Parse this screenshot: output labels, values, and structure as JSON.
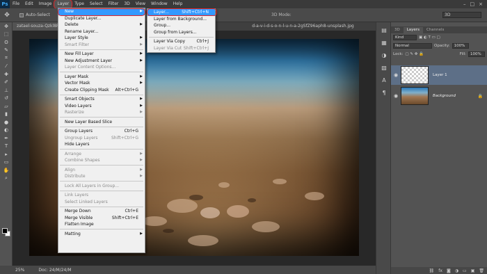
{
  "app": {
    "logo": "Ps"
  },
  "menubar": {
    "items": [
      "File",
      "Edit",
      "Image",
      "Layer",
      "Type",
      "Select",
      "Filter",
      "3D",
      "View",
      "Window",
      "Help"
    ],
    "active": "Layer"
  },
  "options": {
    "auto_select": "Auto-Select",
    "mode3d": "3D Mode:",
    "workspace": "3D"
  },
  "doctabs": {
    "tab1": "zatael-souza-Qzkl8P3A...",
    "tab2": "d-a-v-i-d-s-o-n-l-u-n-a-2gSfZ96aph8-unsplash.jpg"
  },
  "status": {
    "zoom": "25%",
    "doc": "Doc: 24/M/24/M"
  },
  "layer_menu": {
    "groups": [
      [
        {
          "label": "New",
          "arrow": true,
          "highlight": true
        },
        {
          "label": "Duplicate Layer...",
          "arrow": false
        },
        {
          "label": "Delete",
          "arrow": true
        },
        {
          "label": "Rename Layer...",
          "arrow": false
        },
        {
          "label": "Layer Style",
          "arrow": true
        },
        {
          "label": "Smart Filter",
          "arrow": true,
          "disabled": true
        }
      ],
      [
        {
          "label": "New Fill Layer",
          "arrow": true
        },
        {
          "label": "New Adjustment Layer",
          "arrow": true
        },
        {
          "label": "Layer Content Options...",
          "disabled": true
        }
      ],
      [
        {
          "label": "Layer Mask",
          "arrow": true
        },
        {
          "label": "Vector Mask",
          "arrow": true
        },
        {
          "label": "Create Clipping Mask",
          "shortcut": "Alt+Ctrl+G"
        }
      ],
      [
        {
          "label": "Smart Objects",
          "arrow": true
        },
        {
          "label": "Video Layers",
          "arrow": true
        },
        {
          "label": "Rasterize",
          "arrow": true,
          "disabled": true
        }
      ],
      [
        {
          "label": "New Layer Based Slice"
        }
      ],
      [
        {
          "label": "Group Layers",
          "shortcut": "Ctrl+G"
        },
        {
          "label": "Ungroup Layers",
          "shortcut": "Shift+Ctrl+G",
          "disabled": true
        },
        {
          "label": "Hide Layers"
        }
      ],
      [
        {
          "label": "Arrange",
          "arrow": true,
          "disabled": true
        },
        {
          "label": "Combine Shapes",
          "arrow": true,
          "disabled": true
        }
      ],
      [
        {
          "label": "Align",
          "arrow": true,
          "disabled": true
        },
        {
          "label": "Distribute",
          "arrow": true,
          "disabled": true
        }
      ],
      [
        {
          "label": "Lock All Layers in Group...",
          "disabled": true
        }
      ],
      [
        {
          "label": "Link Layers",
          "disabled": true
        },
        {
          "label": "Select Linked Layers",
          "disabled": true
        }
      ],
      [
        {
          "label": "Merge Down",
          "shortcut": "Ctrl+E"
        },
        {
          "label": "Merge Visible",
          "shortcut": "Shift+Ctrl+E"
        },
        {
          "label": "Flatten Image"
        }
      ],
      [
        {
          "label": "Matting",
          "arrow": true
        }
      ]
    ]
  },
  "new_submenu": {
    "groups": [
      [
        {
          "label": "Layer...",
          "shortcut": "Shift+Ctrl+N",
          "highlight": true
        },
        {
          "label": "Layer from Background..."
        },
        {
          "label": "Group..."
        },
        {
          "label": "Group from Layers..."
        }
      ],
      [
        {
          "label": "Layer Via Copy",
          "shortcut": "Ctrl+J"
        },
        {
          "label": "Layer Via Cut",
          "shortcut": "Shift+Ctrl+J",
          "disabled": true
        }
      ]
    ]
  },
  "layers_panel": {
    "tabs": [
      "3D",
      "Layers",
      "Channels"
    ],
    "active_tab": "Layers",
    "filter": "Kind",
    "blend_mode": "Normal",
    "opacity_label": "Opacity:",
    "opacity": "100%",
    "lock_label": "Lock:",
    "fill_label": "Fill:",
    "fill": "100%",
    "layers": [
      {
        "name": "Layer 1",
        "selected": true
      },
      {
        "name": "Background",
        "selected": false,
        "locked": true
      }
    ],
    "bottom_icons": [
      "link-icon",
      "fx-icon",
      "mask-icon",
      "adjustment-icon",
      "folder-icon",
      "new-layer-icon",
      "trash-icon"
    ]
  },
  "colors": {
    "highlight": "#3399ff",
    "annotation": "#e2262b",
    "selected_layer": "#5d6f87"
  }
}
